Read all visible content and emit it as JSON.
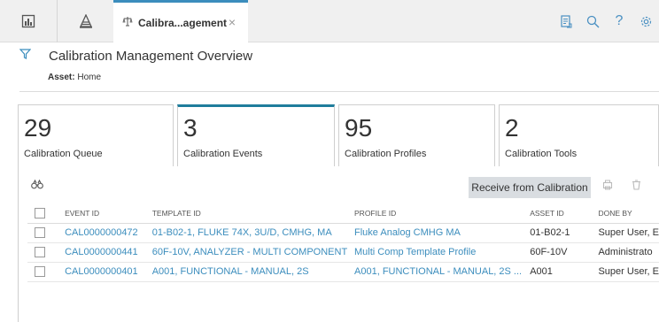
{
  "topbar": {
    "left_icons": [
      "dashboard-icon",
      "asset-hierarchy-icon"
    ],
    "active_tab": {
      "icon": "scale-icon",
      "label": "Calibra...agement",
      "close": "×"
    },
    "right_icons": [
      {
        "name": "document-icon",
        "glyph": "🗎"
      },
      {
        "name": "search-icon",
        "glyph": "⌕"
      },
      {
        "name": "help-icon",
        "glyph": "?"
      },
      {
        "name": "settings-icon",
        "glyph": "⚙"
      }
    ]
  },
  "header": {
    "filter_icon": "filter-icon",
    "title": "Calibration Management Overview",
    "asset_label": "Asset:",
    "asset_value": "Home"
  },
  "cards": [
    {
      "count": "29",
      "label": "Calibration Queue",
      "selected": false
    },
    {
      "count": "3",
      "label": "Calibration Events",
      "selected": true
    },
    {
      "count": "95",
      "label": "Calibration Profiles",
      "selected": false
    },
    {
      "count": "2",
      "label": "Calibration Tools",
      "selected": false
    }
  ],
  "toolbar": {
    "receive_button": "Receive from Calibration",
    "binoculars_icon": "binoculars-icon",
    "action_icons": [
      "copy-icon",
      "delete-icon"
    ]
  },
  "table": {
    "columns": [
      "EVENT ID",
      "TEMPLATE ID",
      "PROFILE ID",
      "ASSET ID",
      "DONE BY"
    ],
    "rows": [
      {
        "event_id": "CAL0000000472",
        "template_id": "01-B02-1, FLUKE 74X, 3U/D, CMHG, MA",
        "profile_id": "Fluke Analog CMHG MA",
        "asset_id": "01-B02-1",
        "done_by": "Super User, E"
      },
      {
        "event_id": "CAL0000000441",
        "template_id": "60F-10V, ANALYZER - MULTI COMPONENT",
        "profile_id": "Multi Comp Template Profile",
        "asset_id": "60F-10V",
        "done_by": "Administrato"
      },
      {
        "event_id": "CAL0000000401",
        "template_id": "A001, FUNCTIONAL - MANUAL, 2S",
        "profile_id": "A001, FUNCTIONAL - MANUAL, 2S ...",
        "asset_id": "A001",
        "done_by": "Super User, E"
      }
    ]
  }
}
